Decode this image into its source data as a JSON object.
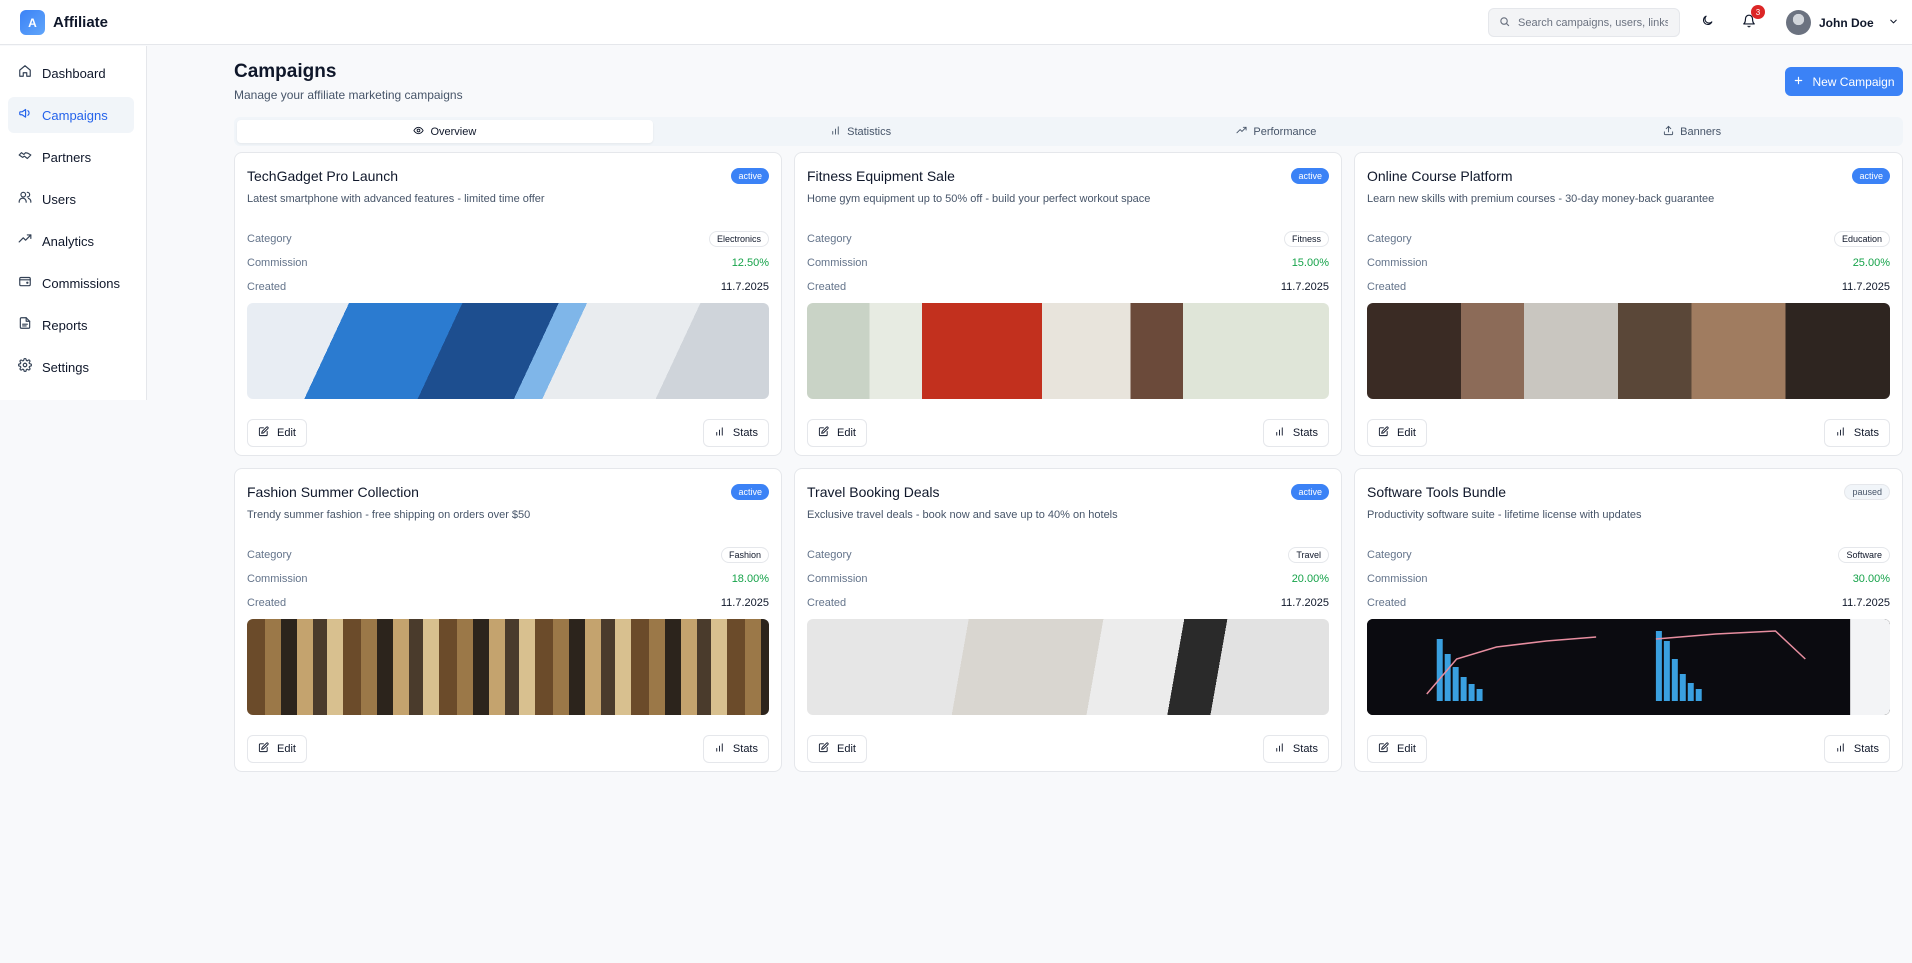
{
  "app": {
    "logo_letter": "A",
    "name": "Affiliate"
  },
  "header": {
    "search_placeholder": "Search campaigns, users, links...",
    "notifications_count": "3",
    "user_name": "John Doe"
  },
  "sidebar": {
    "items": [
      {
        "label": "Dashboard",
        "icon": "home-icon",
        "active": false
      },
      {
        "label": "Campaigns",
        "icon": "megaphone-icon",
        "active": true
      },
      {
        "label": "Partners",
        "icon": "handshake-icon",
        "active": false
      },
      {
        "label": "Users",
        "icon": "users-icon",
        "active": false
      },
      {
        "label": "Analytics",
        "icon": "trending-up-icon",
        "active": false
      },
      {
        "label": "Commissions",
        "icon": "wallet-icon",
        "active": false
      },
      {
        "label": "Reports",
        "icon": "file-icon",
        "active": false
      },
      {
        "label": "Settings",
        "icon": "gear-icon",
        "active": false
      }
    ]
  },
  "page": {
    "title": "Campaigns",
    "subtitle": "Manage your affiliate marketing campaigns",
    "new_button": "New Campaign"
  },
  "tabs": [
    {
      "label": "Overview",
      "icon": "eye-icon",
      "active": true
    },
    {
      "label": "Statistics",
      "icon": "bar-chart-icon",
      "active": false
    },
    {
      "label": "Performance",
      "icon": "trending-up-icon",
      "active": false
    },
    {
      "label": "Banners",
      "icon": "upload-icon",
      "active": false
    }
  ],
  "labels": {
    "category": "Category",
    "commission": "Commission",
    "created": "Created",
    "edit": "Edit",
    "stats": "Stats"
  },
  "campaigns": [
    {
      "title": "TechGadget Pro Launch",
      "status": "active",
      "description": "Latest smartphone with advanced features - limited time offer",
      "category": "Electronics",
      "commission": "12.50%",
      "created": "11.7.2025"
    },
    {
      "title": "Fitness Equipment Sale",
      "status": "active",
      "description": "Home gym equipment up to 50% off - build your perfect workout space",
      "category": "Fitness",
      "commission": "15.00%",
      "created": "11.7.2025"
    },
    {
      "title": "Online Course Platform",
      "status": "active",
      "description": "Learn new skills with premium courses - 30-day money-back guarantee",
      "category": "Education",
      "commission": "25.00%",
      "created": "11.7.2025"
    },
    {
      "title": "Fashion Summer Collection",
      "status": "active",
      "description": "Trendy summer fashion - free shipping on orders over $50",
      "category": "Fashion",
      "commission": "18.00%",
      "created": "11.7.2025"
    },
    {
      "title": "Travel Booking Deals",
      "status": "active",
      "description": "Exclusive travel deals - book now and save up to 40% on hotels",
      "category": "Travel",
      "commission": "20.00%",
      "created": "11.7.2025"
    },
    {
      "title": "Software Tools Bundle",
      "status": "paused",
      "description": "Productivity software suite - lifetime license with updates",
      "category": "Software",
      "commission": "30.00%",
      "created": "11.7.2025"
    }
  ],
  "colors": {
    "accent": "#3b82f6",
    "active_nav_text": "#2563eb",
    "commission_green": "#16a34a",
    "notification_red": "#dc2626"
  }
}
